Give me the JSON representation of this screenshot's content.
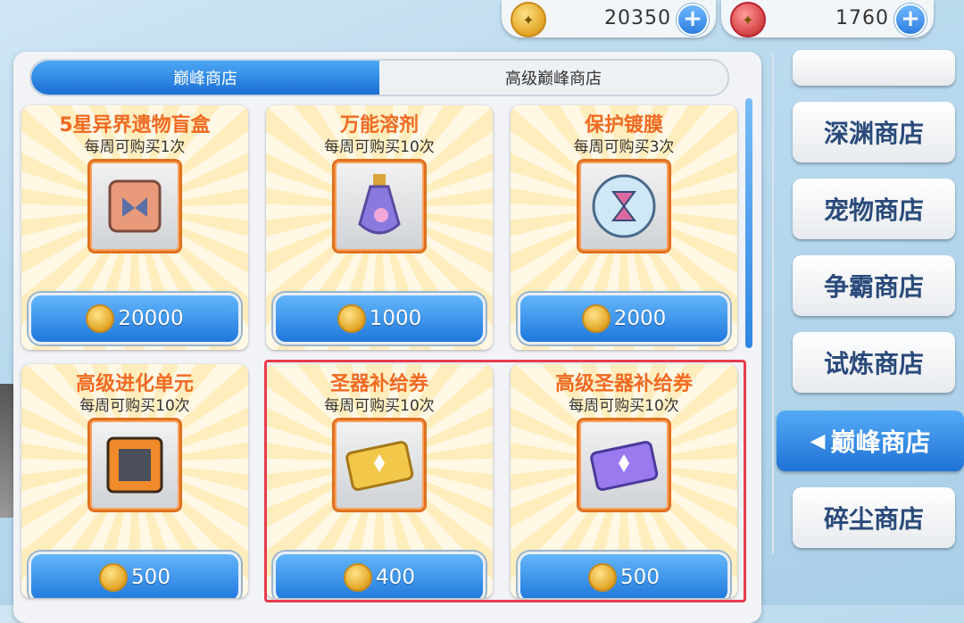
{
  "currency": {
    "gold_amount": "20350",
    "red_amount": "1760",
    "plus_symbol": "+"
  },
  "tabs": [
    {
      "label": "巅峰商店",
      "active": true
    },
    {
      "label": "高级巅峰商店",
      "active": false
    }
  ],
  "items": [
    {
      "name": "5星异界遗物盲盒",
      "limit": "每周可购买1次",
      "price": "20000",
      "icon": "relic-box-icon"
    },
    {
      "name": "万能溶剂",
      "limit": "每周可购买10次",
      "price": "1000",
      "icon": "potion-bottle-icon"
    },
    {
      "name": "保护镀膜",
      "limit": "每周可购买3次",
      "price": "2000",
      "icon": "hourglass-orb-icon"
    },
    {
      "name": "高级进化单元",
      "limit": "每周可购买10次",
      "price": "500",
      "icon": "evolution-unit-icon"
    },
    {
      "name": "圣器补给券",
      "limit": "每周可购买10次",
      "price": "400",
      "icon": "gold-ticket-icon"
    },
    {
      "name": "高级圣器补给券",
      "limit": "每周可购买10次",
      "price": "500",
      "icon": "purple-ticket-icon"
    }
  ],
  "side_nav": [
    {
      "label": "深渊商店"
    },
    {
      "label": "宠物商店"
    },
    {
      "label": "争霸商店"
    },
    {
      "label": "试炼商店"
    },
    {
      "label": "巅峰商店",
      "active": true
    },
    {
      "label": "碎尘商店"
    }
  ],
  "colors": {
    "accent_blue": "#1f78dc",
    "title_orange": "#f06a22",
    "highlight_red": "#e83c4c"
  }
}
